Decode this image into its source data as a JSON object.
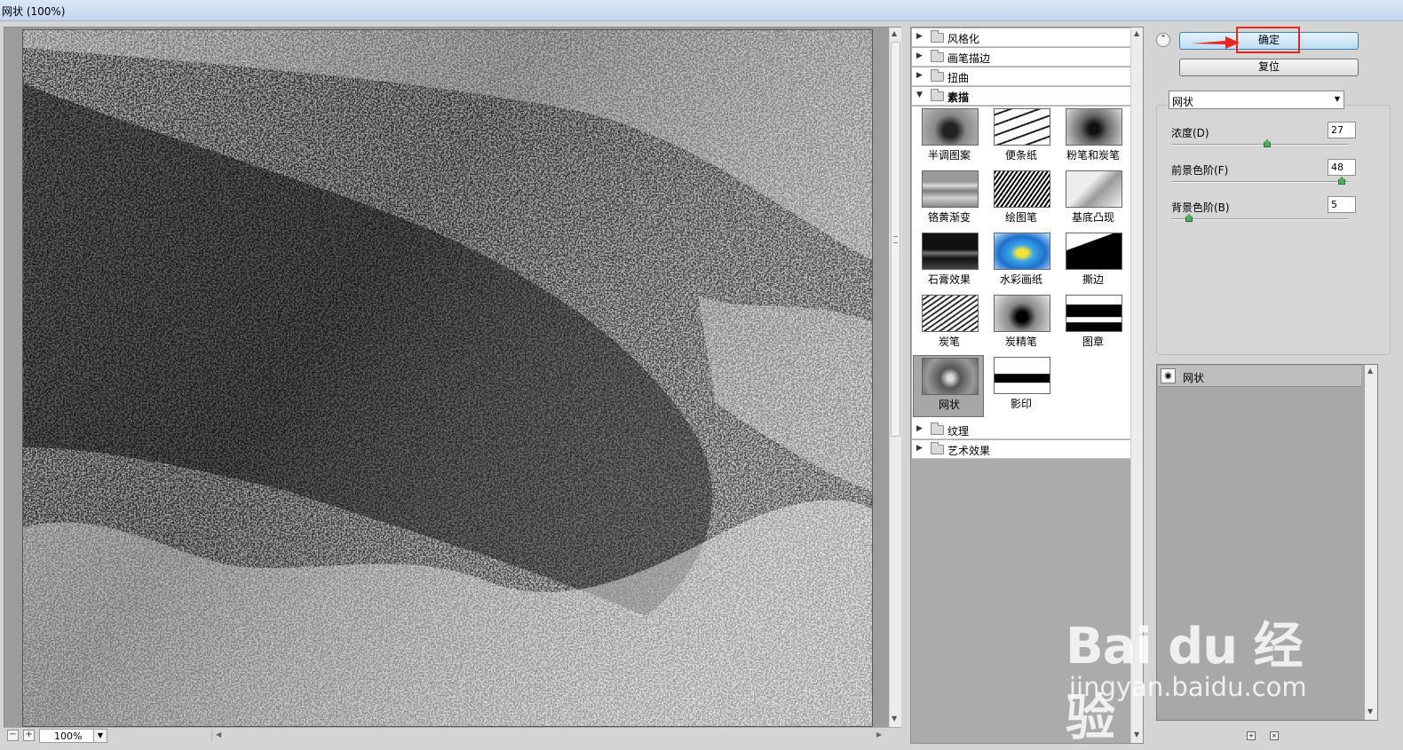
{
  "window": {
    "title": "网状 (100%)"
  },
  "preview": {
    "zoom": "100%"
  },
  "gallery": {
    "categories_top": [
      {
        "label": "风格化",
        "expanded": false
      },
      {
        "label": "画笔描边",
        "expanded": false
      },
      {
        "label": "扭曲",
        "expanded": false
      },
      {
        "label": "素描",
        "expanded": true
      }
    ],
    "filters": [
      {
        "label": "半调图案",
        "icon": "halftone-thumb"
      },
      {
        "label": "便条纸",
        "icon": "note-paper-thumb"
      },
      {
        "label": "粉笔和炭笔",
        "icon": "chalk-charcoal-thumb"
      },
      {
        "label": "铬黄渐变",
        "icon": "chrome-thumb"
      },
      {
        "label": "绘图笔",
        "icon": "graphic-pen-thumb"
      },
      {
        "label": "基底凸现",
        "icon": "bas-relief-thumb"
      },
      {
        "label": "石膏效果",
        "icon": "plaster-thumb"
      },
      {
        "label": "水彩画纸",
        "icon": "water-paper-thumb"
      },
      {
        "label": "撕边",
        "icon": "torn-edges-thumb"
      },
      {
        "label": "炭笔",
        "icon": "charcoal-thumb"
      },
      {
        "label": "炭精笔",
        "icon": "conte-crayon-thumb"
      },
      {
        "label": "图章",
        "icon": "stamp-thumb"
      },
      {
        "label": "网状",
        "icon": "reticulation-thumb",
        "selected": true
      },
      {
        "label": "影印",
        "icon": "photocopy-thumb"
      }
    ],
    "categories_bottom": [
      {
        "label": "纹理",
        "expanded": false
      },
      {
        "label": "艺术效果",
        "expanded": false
      }
    ]
  },
  "settings": {
    "ok_label": "确定",
    "reset_label": "复位",
    "filter_select": "网状",
    "params": [
      {
        "label": "浓度(D)",
        "value": "27",
        "level": 0.54
      },
      {
        "label": "前景色阶(F)",
        "value": "48",
        "level": 0.96
      },
      {
        "label": "背景色阶(B)",
        "value": "5",
        "level": 0.1
      }
    ]
  },
  "layers": {
    "items": [
      {
        "name": "网状",
        "visible": true
      }
    ]
  },
  "watermark": {
    "logo": "Bai du 经验",
    "url": "jingyan.baidu.com"
  },
  "colors": {
    "highlight": "#e8241c",
    "ok_button": "#bcdcf2",
    "slider_knob": "#4fae5e"
  }
}
